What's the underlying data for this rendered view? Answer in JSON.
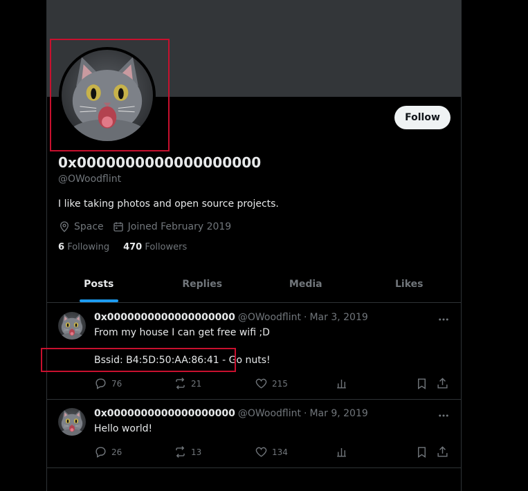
{
  "profile": {
    "display_name": "0x0000000000000000000",
    "handle": "@OWoodflint",
    "bio": "I like taking photos and open source projects.",
    "location": "Space",
    "joined": "Joined February 2019",
    "following_count": "6",
    "following_label": "Following",
    "followers_count": "470",
    "followers_label": "Followers",
    "follow_label": "Follow"
  },
  "tabs": [
    {
      "label": "Posts",
      "active": true
    },
    {
      "label": "Replies",
      "active": false
    },
    {
      "label": "Media",
      "active": false
    },
    {
      "label": "Likes",
      "active": false
    }
  ],
  "posts": [
    {
      "name": "0x0000000000000000000",
      "handle": "@OWoodflint",
      "sep": "·",
      "date": "Mar 3, 2019",
      "line1": "From my house I can get free wifi ;D",
      "line2": "Bssid: B4:5D:50:AA:86:41 - Go nuts!",
      "replies": "76",
      "reposts": "21",
      "likes": "215"
    },
    {
      "name": "0x0000000000000000000",
      "handle": "@OWoodflint",
      "sep": "·",
      "date": "Mar 9, 2019",
      "line1": "Hello world!",
      "replies": "26",
      "reposts": "13",
      "likes": "134"
    }
  ],
  "icons": {
    "location": "location-pin-icon",
    "calendar": "calendar-icon",
    "reply": "reply-icon",
    "repost": "repost-icon",
    "like": "heart-icon",
    "views": "analytics-icon",
    "bookmark": "bookmark-icon",
    "share": "share-icon",
    "more": "more-icon"
  },
  "colors": {
    "background": "#000000",
    "banner": "#333639",
    "accent": "#1d9bf0",
    "muted": "#71767b",
    "text": "#e7e9ea",
    "highlight": "#c8102e"
  }
}
